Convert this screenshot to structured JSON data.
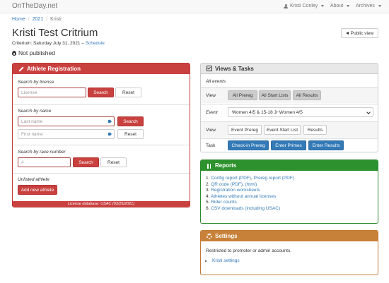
{
  "navbar": {
    "brand": "OnTheDay.net",
    "user": "Kristi Conley",
    "about": "About",
    "archives": "Archives"
  },
  "breadcrumb": [
    "Home",
    "2021",
    "Kristi"
  ],
  "page": {
    "title": "Kristi Test Critrium",
    "public_view": "Public view",
    "subtitle_prefix": "Criterium: Saturday July 31, 2021 –",
    "schedule_link": "Schedule",
    "status": "Not published"
  },
  "registration": {
    "title": "Athlete Registration",
    "license": {
      "label": "Search by license",
      "placeholder": "License",
      "search": "Search",
      "reset": "Reset"
    },
    "name": {
      "label": "Search by name",
      "last_placeholder": "Last name",
      "first_placeholder": "First name",
      "search": "Search",
      "reset": "Reset"
    },
    "race_number": {
      "label": "Search by race number",
      "placeholder": "#",
      "search": "Search",
      "reset": "Reset"
    },
    "unlisted": {
      "label": "Unlisted athlete",
      "button": "Add new athlete"
    },
    "footer": "License database: USAC (03/25/2021)"
  },
  "views": {
    "title": "Views & Tasks",
    "all_events": "All events",
    "row1": {
      "label": "View",
      "buttons": [
        "All Prereg",
        "All Start Lists",
        "All Results"
      ]
    },
    "event": {
      "label": "Event",
      "selected": "Women 4/5 & 15-18 Jr Women 4/5"
    },
    "row3": {
      "label": "View",
      "buttons": [
        "Event Prereg",
        "Event Start List",
        "Results"
      ]
    },
    "task": {
      "label": "Task",
      "buttons": [
        "Check-in Prereg",
        "Enter Primes",
        "Enter Results"
      ]
    }
  },
  "reports": {
    "title": "Reports",
    "items": [
      {
        "num": "1.",
        "parts": [
          "Config report (PDF)",
          ", ",
          "Prereg report (PDF)"
        ]
      },
      {
        "num": "2.",
        "parts": [
          "QR code (PDF)",
          ", ",
          "(html)"
        ]
      },
      {
        "num": "3.",
        "parts": [
          "Registration worksheets"
        ]
      },
      {
        "num": "4.",
        "parts": [
          "Athletes without annual licenses"
        ]
      },
      {
        "num": "5.",
        "parts": [
          "Rider counts"
        ]
      },
      {
        "num": "6.",
        "parts": [
          "CSV downloads (including USAC)"
        ]
      }
    ]
  },
  "settings": {
    "title": "Settings",
    "text": "Restricted to promoter or admin accounts.",
    "link": "Kristi settings"
  },
  "colors": {
    "registration": "#c9413f",
    "reports": "#2d922d",
    "settings": "#c88139",
    "primary": "#337ab7"
  }
}
